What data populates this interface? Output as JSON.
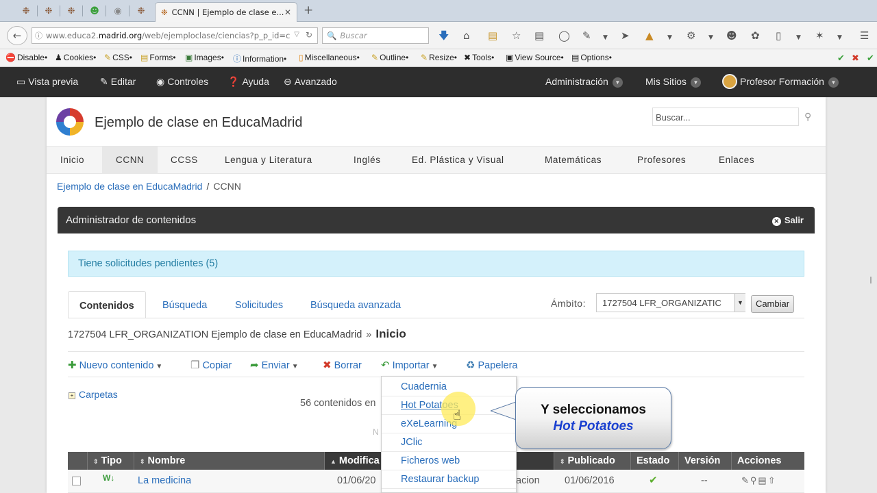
{
  "browser": {
    "active_tab_title": "CCNN | Ejemplo de clase e...",
    "url_prefix": "www.educa2.",
    "url_domain": "madrid.org",
    "url_suffix": "/web/ejemploclase/ciencias?p_p_id=c",
    "search_placeholder": "Buscar"
  },
  "bookmarks": [
    "Disable•",
    "Cookies•",
    "CSS•",
    "Forms•",
    "Images•",
    "Information•",
    "Miscellaneous•",
    "Outline•",
    "Resize•",
    "Tools•",
    "View Source•",
    "Options•"
  ],
  "dockbar": {
    "vista_previa": "Vista previa",
    "editar": "Editar",
    "controles": "Controles",
    "ayuda": "Ayuda",
    "avanzado": "Avanzado",
    "administracion": "Administración",
    "mis_sitios": "Mis Sitios",
    "user": "Profesor Formación"
  },
  "site": {
    "title": "Ejemplo de clase en EducaMadrid",
    "search_placeholder": "Buscar...",
    "nav": [
      "Inicio",
      "CCNN",
      "CCSS",
      "Lengua y Literatura",
      "Inglés",
      "Ed. Plástica y Visual",
      "Matemáticas",
      "Profesores",
      "Enlaces"
    ],
    "active_nav": "CCNN",
    "breadcrumb": [
      "Ejemplo de clase en EducaMadrid",
      "CCNN"
    ]
  },
  "admin": {
    "title": "Administrador de contenidos",
    "exit": "Salir",
    "alert": "Tiene solicitudes pendientes (5)",
    "tabs": [
      "Contenidos",
      "Búsqueda",
      "Solicitudes",
      "Búsqueda avanzada"
    ],
    "ambito_label": "Ámbito:",
    "ambito_value": "1727504 LFR_ORGANIZATIC",
    "change_button": "Cambiar",
    "path_prefix": "1727504 LFR_ORGANIZATION Ejemplo de clase en EducaMadrid",
    "path_current": "Inicio",
    "toolbar": {
      "nuevo": "Nuevo contenido",
      "copiar": "Copiar",
      "enviar": "Enviar",
      "borrar": "Borrar",
      "importar": "Importar",
      "papelera": "Papelera"
    },
    "folders": "Carpetas",
    "count": "56 contenidos en",
    "columns": [
      "Tipo",
      "Nombre",
      "Modifica",
      "Publicado",
      "Estado",
      "Versión",
      "Acciones"
    ],
    "row": {
      "name": "La medicina",
      "modified": "01/06/20",
      "author_fragment": "acion",
      "published": "01/06/2016",
      "version": "--"
    }
  },
  "import_menu": {
    "items": [
      "Cuadernia",
      "Hot Potatoes",
      "eXeLearning",
      "JClic",
      "Ficheros web",
      "Restaurar backup"
    ],
    "hovered": "Hot Potatoes"
  },
  "callout": {
    "line1": "Y seleccionamos",
    "line2": "Hot Potatoes"
  }
}
